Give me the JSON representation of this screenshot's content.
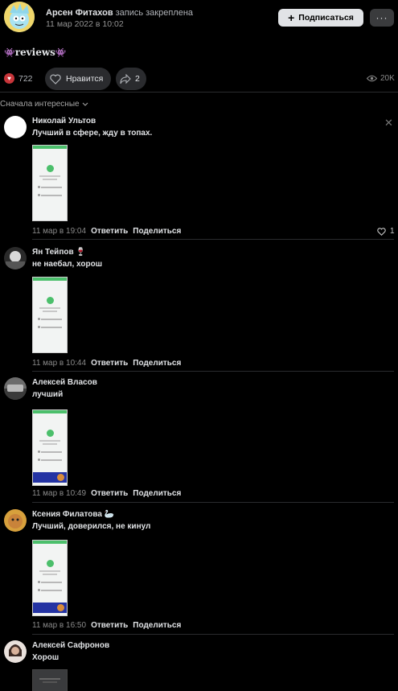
{
  "post": {
    "author": "Арсен Фитахов",
    "pinned_note": "запись закреплена",
    "date": "11 мар 2022 в 10:02",
    "subscribe_label": "Подписаться",
    "more_label": "···",
    "text": "reviews",
    "reactions_count": "722",
    "like_label": "Нравится",
    "share_count": "2",
    "views": "20K"
  },
  "sort_label": "Сначала интересные",
  "reply_label": "Ответить",
  "share_label": "Поделиться",
  "comments": [
    {
      "name": "Николай Ультов",
      "text": "Лучший в сфере, жду в топах.",
      "date": "11 мар в 19:04",
      "likes": "1"
    },
    {
      "name": "Ян Тейпов",
      "text": "не наебал, хорош",
      "date": "11 мар в 10:44"
    },
    {
      "name": "Алексей Власов",
      "text": "лучший",
      "date": "11 мар в 10:49"
    },
    {
      "name": "Ксения Филатова",
      "text": "Лучший, доверился, не кинул",
      "date": "11 мар в 16:50"
    },
    {
      "name": "Алексей Сафронов",
      "text": "Хорош"
    }
  ],
  "colors": {
    "background": "#000000",
    "accent_red": "#c8353a",
    "button": "#2a2b2e"
  }
}
